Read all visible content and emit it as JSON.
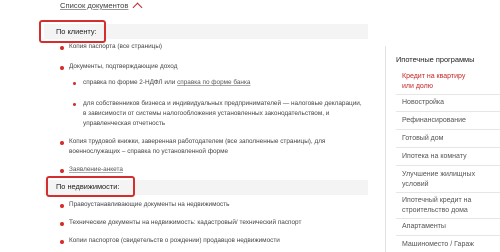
{
  "documents_toggle": {
    "label": "Список документов",
    "icon": "chevron-up-icon"
  },
  "client_section": {
    "title": "По клиенту:",
    "items": [
      {
        "text": "Копия паспорта (все страницы)"
      },
      {
        "text": "Документы, подтверждающие доход",
        "subitems": [
          {
            "prefix": "справка по форме 2-НДФЛ или ",
            "link": "справка по форме банка"
          },
          {
            "text_lines": [
              "для собственников бизнеса и индивидуальных предпринимателей — налоговые декларации,",
              "в зависимости от системы налогообложения установленных законодательством, и",
              "управленческая отчетность"
            ]
          }
        ]
      },
      {
        "text_lines": [
          "Копия трудовой книжки, заверенная работодателем (все заполненные страницы), для",
          "военнослужащих – справка по установленной форме"
        ]
      },
      {
        "link": "Заявление-анкета"
      }
    ]
  },
  "property_section": {
    "title": "По недвижимости:",
    "items": [
      {
        "text": "Правоустанавливающие документы на недвижимость"
      },
      {
        "text": "Технические документы на недвижимость: кадастровый/ технический паспорт"
      },
      {
        "text": "Копии паспортов (свидетельств о рождении) продавцов недвижимости"
      }
    ]
  },
  "sidebar": {
    "title": "Ипотечные программы",
    "items": [
      {
        "label_lines": [
          "Кредит на квартиру",
          "или долю"
        ],
        "active": true
      },
      {
        "label_lines": [
          "Новостройка"
        ],
        "active": false
      },
      {
        "label_lines": [
          "Рефинансирование"
        ],
        "active": false
      },
      {
        "label_lines": [
          "Готовый дом"
        ],
        "active": false
      },
      {
        "label_lines": [
          "Ипотека на комнату"
        ],
        "active": false
      },
      {
        "label_lines": [
          "Улучшение жилищных",
          "условий"
        ],
        "active": false
      },
      {
        "label_lines": [
          "Ипотечный кредит на",
          "строительство дома"
        ],
        "active": false
      },
      {
        "label_lines": [
          "Апартаменты"
        ],
        "active": false
      },
      {
        "label_lines": [
          "Машиноместо / Гараж"
        ],
        "active": false
      }
    ]
  },
  "colors": {
    "accent": "#d32f2f",
    "band": "#f4f4f4",
    "text": "#444444"
  }
}
